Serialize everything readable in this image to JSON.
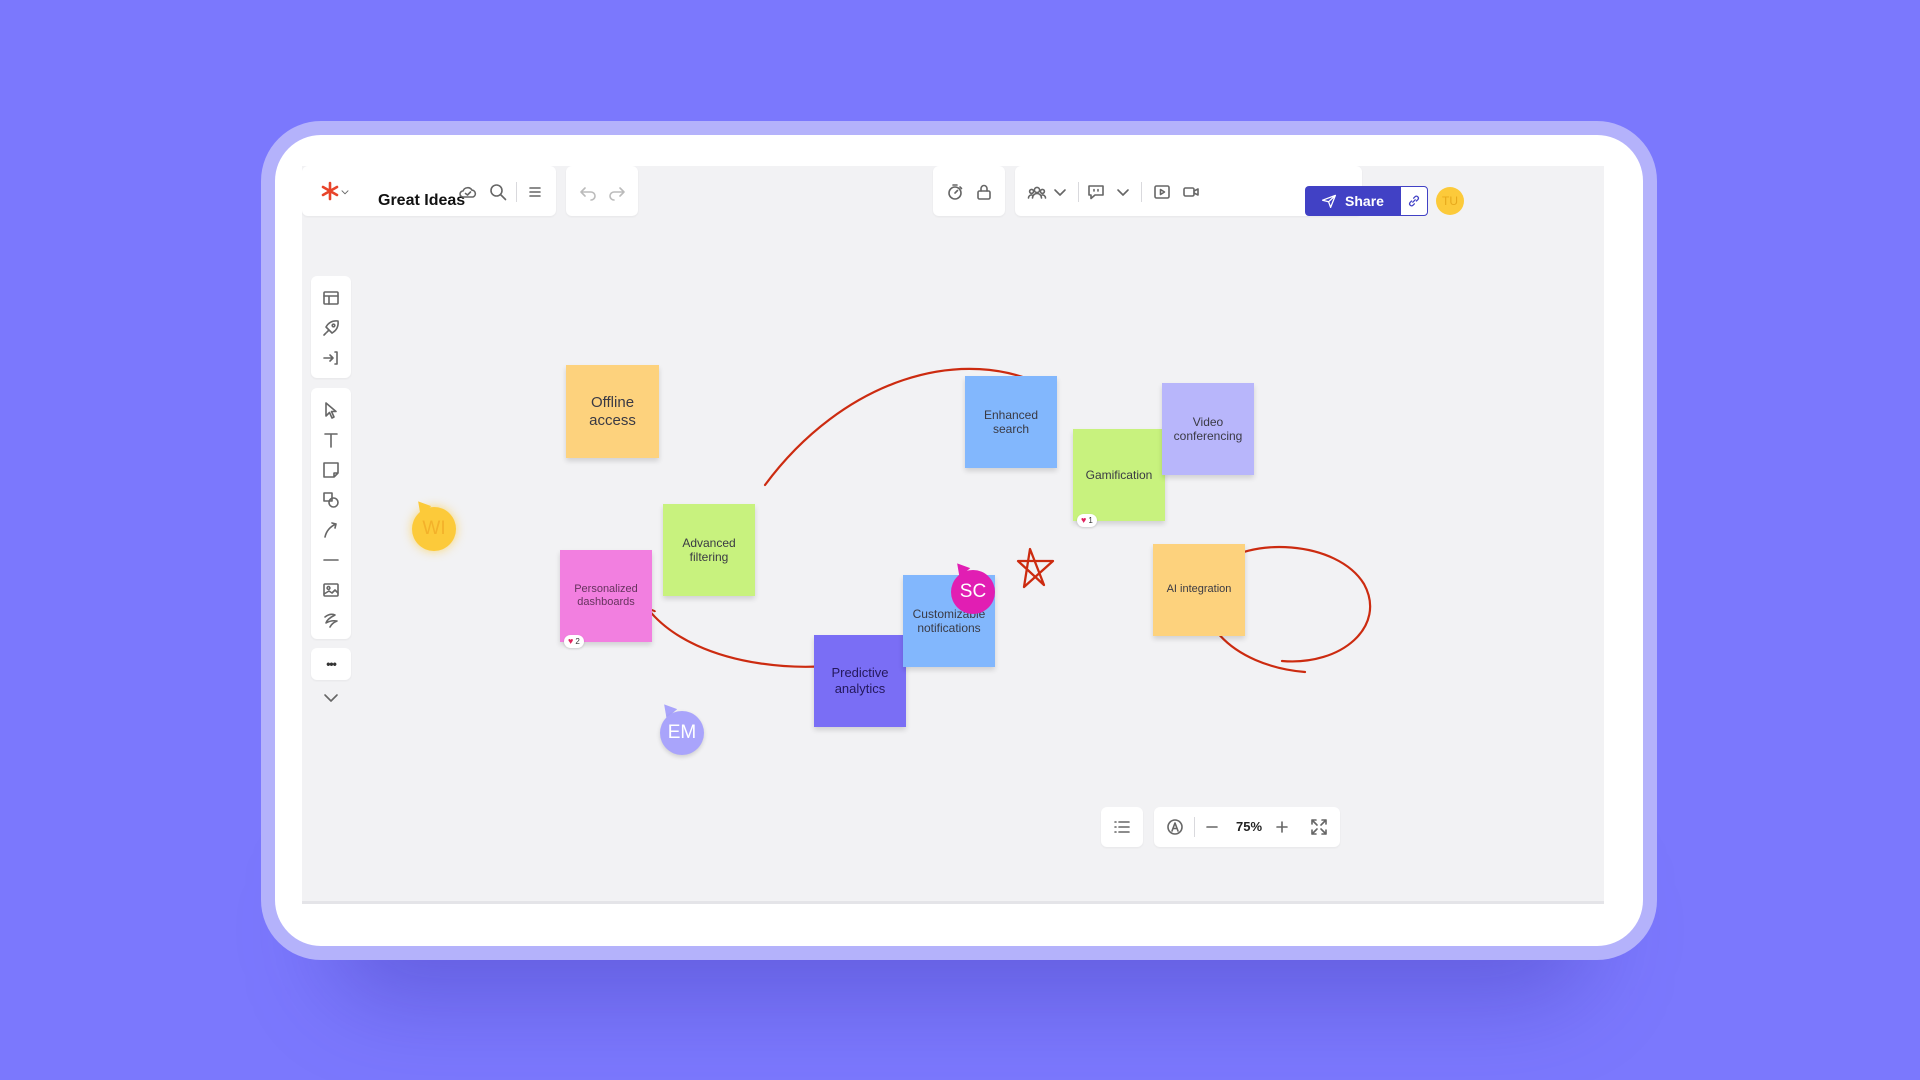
{
  "board": {
    "title": "Great Ideas"
  },
  "share": {
    "label": "Share",
    "owner_initials": "TU"
  },
  "zoom": {
    "level": "75%"
  },
  "more_label": "•••",
  "stickies": [
    {
      "text": "Offline access",
      "color": "#fdd27d"
    },
    {
      "text": "Advanced filtering",
      "color": "#c8f27e"
    },
    {
      "text": "Enhanced search",
      "color": "#82b7fd"
    },
    {
      "text": "Gamification",
      "color": "#c8f27e"
    },
    {
      "text": "Video conferencing",
      "color": "#b8b6fb"
    },
    {
      "text": "Personalized dashboards",
      "color": "#f27fe0"
    },
    {
      "text": "Predictive analytics",
      "color": "#7a6ef5"
    },
    {
      "text": "Customizable notifications",
      "color": "#82b7fd"
    },
    {
      "text": "AI integration",
      "color": "#fdd27d"
    }
  ],
  "likes": {
    "gamification": "1",
    "dashboards": "2"
  },
  "collaborators": [
    {
      "initials": "WI",
      "color": "#fcca3a"
    },
    {
      "initials": "SC",
      "color": "#e11eb3"
    },
    {
      "initials": "EM",
      "color": "#a9a4fb"
    }
  ],
  "colors": {
    "background": "#7b78fd",
    "accent": "#4141c5",
    "annotation": "#cc2b10"
  }
}
